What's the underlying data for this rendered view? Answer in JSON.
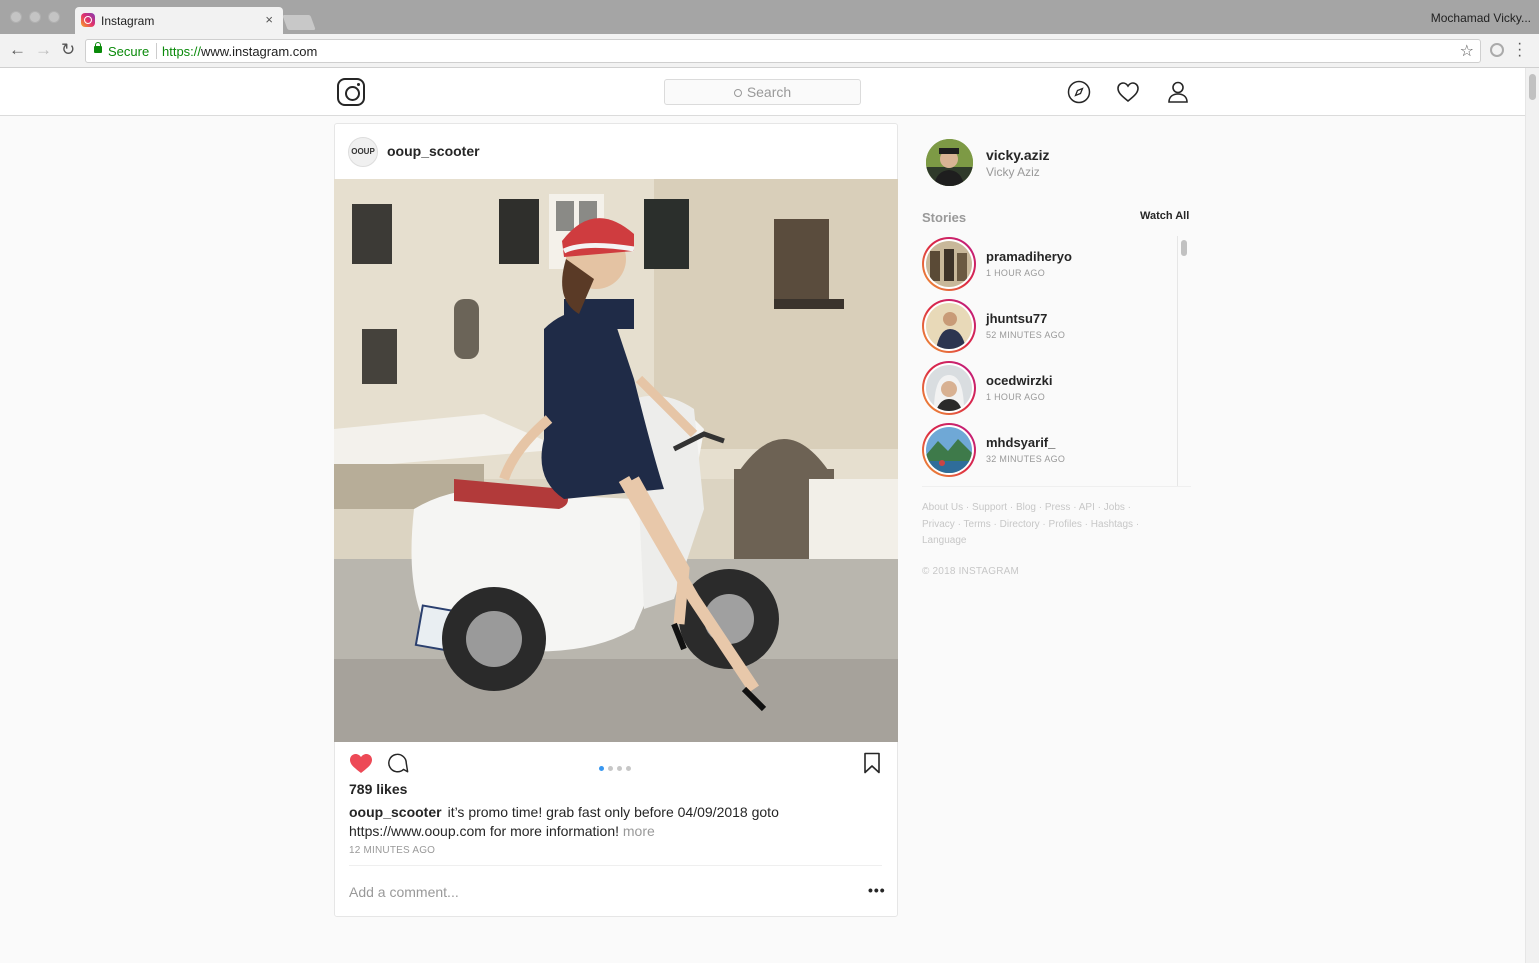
{
  "browser": {
    "tab_title": "Instagram",
    "tab_close": "×",
    "profile_name": "Mochamad Vicky...",
    "secure_label": "Secure",
    "url_scheme": "https://",
    "url_host": "www.instagram.com"
  },
  "header": {
    "search_placeholder": "Search",
    "icons": [
      "explore-icon",
      "heart-icon",
      "profile-icon"
    ]
  },
  "post": {
    "username": "ooup_scooter",
    "avatar_text": "OOUP",
    "likes": "789 likes",
    "caption_user": "ooup_scooter",
    "caption_text": "it’s promo time! grab fast only before 04/09/2018 goto https://www.ooup.com for more information!",
    "caption_more": "more",
    "time": "12 MINUTES AGO",
    "comment_placeholder": "Add a comment...",
    "more_options": "•••",
    "carousel_count": 4,
    "carousel_active": 1
  },
  "sidebar": {
    "username": "vicky.aziz",
    "full_name": "Vicky Aziz",
    "stories_label": "Stories",
    "watch_all": "Watch All",
    "stories": [
      {
        "user": "pramadiheryo",
        "time": "1 HOUR AGO"
      },
      {
        "user": "jhuntsu77",
        "time": "52 MINUTES AGO"
      },
      {
        "user": "ocedwirzki",
        "time": "1 HOUR AGO"
      },
      {
        "user": "mhdsyarif_",
        "time": "32 MINUTES AGO"
      }
    ],
    "footer_links": [
      "About Us",
      "Support",
      "Blog",
      "Press",
      "API",
      "Jobs",
      "Privacy",
      "Terms",
      "Directory",
      "Profiles",
      "Hashtags",
      "Language"
    ],
    "copyright": "© 2018 INSTAGRAM"
  },
  "colors": {
    "like_red": "#ed4956",
    "link_blue": "#3897f0",
    "secure_green": "#0a8a0a"
  }
}
